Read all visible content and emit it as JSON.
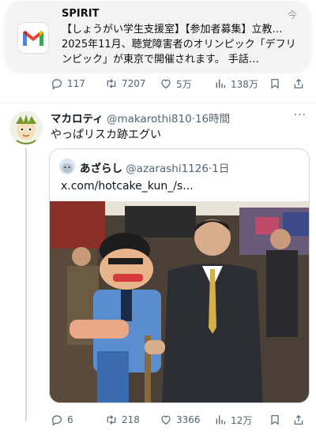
{
  "notification": {
    "app": "SPIRIT",
    "time": "今",
    "body": "【しょうがい学生支援室】【参加者募集】立教… 2025年11月、聴覚障害者のオリンピック「デフリンピック」が東京で開催されます。 手話…",
    "icon": "gmail-icon"
  },
  "top_actions": {
    "replies": "117",
    "retweets": "7207",
    "likes": "5万",
    "views": "138万"
  },
  "tweet": {
    "display_name": "マカロティ",
    "handle": "@makarothi810",
    "time": "16時間",
    "more": "···",
    "text": "やっぱリスカ跡エグい",
    "quote": {
      "display_name": "あざらし",
      "handle": "@azarashi1126",
      "time": "1日",
      "text": "x.com/hotcake_kun_/s..."
    },
    "actions": {
      "replies": "6",
      "retweets": "218",
      "likes": "3366",
      "views": "12万"
    }
  },
  "colors": {
    "text": "#0f1419",
    "secondary": "#536471",
    "border": "#cfd9de",
    "gmail_red": "#ea4335"
  }
}
